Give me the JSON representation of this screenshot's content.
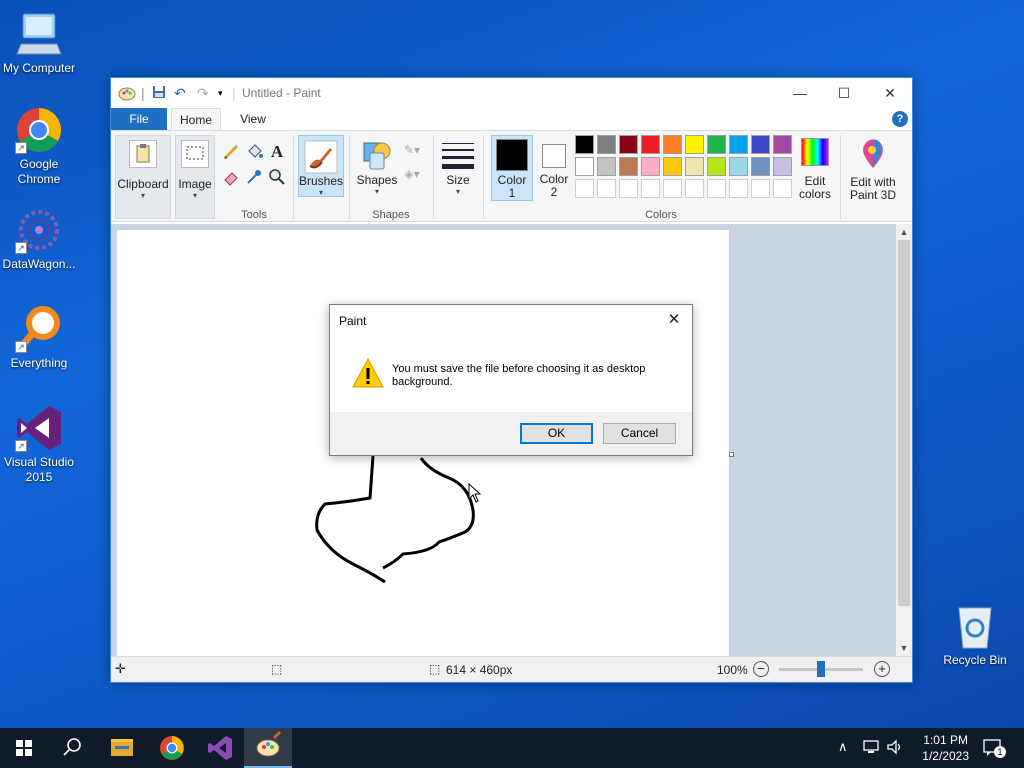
{
  "desktop": {
    "icons": [
      {
        "label": "My Computer"
      },
      {
        "label": "Google Chrome"
      },
      {
        "label": "DataWagon..."
      },
      {
        "label": "Everything"
      },
      {
        "label": "Visual Studio 2015"
      },
      {
        "label": "Recycle Bin"
      }
    ]
  },
  "window": {
    "title": "Untitled - Paint",
    "tabs": {
      "file": "File",
      "home": "Home",
      "view": "View"
    },
    "help": "?"
  },
  "ribbon": {
    "clipboard": "Clipboard",
    "image": "Image",
    "tools_group": "Tools",
    "brushes": "Brushes",
    "shapes": "Shapes",
    "shapes_group": "Shapes",
    "size": "Size",
    "color1_line1": "Color",
    "color1_line2": "1",
    "color2_line1": "Color",
    "color2_line2": "2",
    "edit_colors_line1": "Edit",
    "edit_colors_line2": "colors",
    "edit3d_line1": "Edit with",
    "edit3d_line2": "Paint 3D",
    "colors_group": "Colors",
    "text_tool": "A"
  },
  "palette": {
    "row1": [
      "#000000",
      "#7f7f7f",
      "#880015",
      "#ed1c24",
      "#ff7f27",
      "#fff200",
      "#22b14c",
      "#00a2e8",
      "#3f48cc",
      "#a349a4"
    ],
    "row2": [
      "#ffffff",
      "#c3c3c3",
      "#b97a57",
      "#ffaec9",
      "#ffc90e",
      "#efe4b0",
      "#b5e61d",
      "#99d9ea",
      "#7092be",
      "#c8bfe7"
    ],
    "primary": "#000000",
    "secondary": "#ffffff"
  },
  "statusbar": {
    "dimensions": "614 × 460px",
    "zoom": "100%",
    "zoom_fraction": 0.5
  },
  "dialog": {
    "title": "Paint",
    "message": "You must save the file before choosing it as desktop background.",
    "ok": "OK",
    "cancel": "Cancel"
  },
  "taskbar": {
    "time": "1:01 PM",
    "date": "1/2/2023",
    "notifications": "1"
  }
}
